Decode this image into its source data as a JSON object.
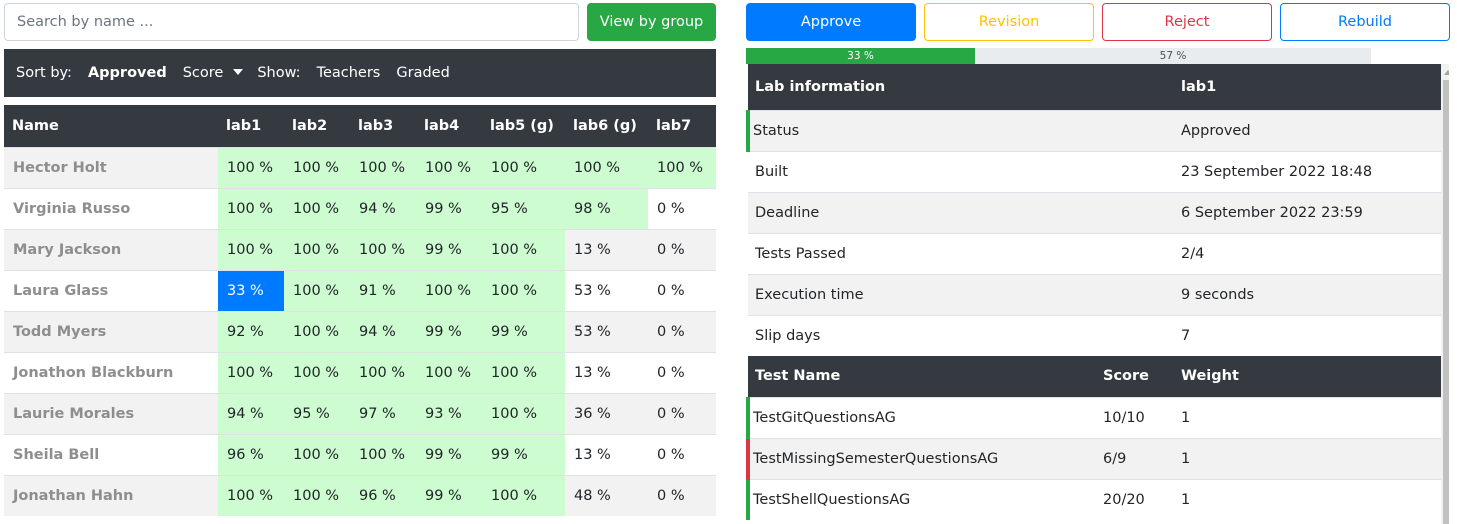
{
  "search": {
    "placeholder": "Search by name ..."
  },
  "view_by_group_label": "View by group",
  "sortbar": {
    "sort_by_label": "Sort by:",
    "approved_label": "Approved",
    "score_label": "Score",
    "show_label": "Show:",
    "teachers_label": "Teachers",
    "graded_label": "Graded"
  },
  "results_table": {
    "headers": [
      "Name",
      "lab1",
      "lab2",
      "lab3",
      "lab4",
      "lab5 (g)",
      "lab6 (g)",
      "lab7"
    ],
    "rows": [
      {
        "name": "Hector Holt",
        "cells": [
          "100 %",
          "100 %",
          "100 %",
          "100 %",
          "100 %",
          "100 %",
          "100 %"
        ]
      },
      {
        "name": "Virginia Russo",
        "cells": [
          "100 %",
          "100 %",
          "94 %",
          "99 %",
          "95 %",
          "98 %",
          "0 %"
        ]
      },
      {
        "name": "Mary Jackson",
        "cells": [
          "100 %",
          "100 %",
          "100 %",
          "99 %",
          "100 %",
          "13 %",
          "0 %"
        ]
      },
      {
        "name": "Laura Glass",
        "cells": [
          "33 %",
          "100 %",
          "91 %",
          "100 %",
          "100 %",
          "53 %",
          "0 %"
        ]
      },
      {
        "name": "Todd Myers",
        "cells": [
          "92 %",
          "100 %",
          "94 %",
          "99 %",
          "99 %",
          "53 %",
          "0 %"
        ]
      },
      {
        "name": "Jonathon Blackburn",
        "cells": [
          "100 %",
          "100 %",
          "100 %",
          "100 %",
          "100 %",
          "13 %",
          "0 %"
        ]
      },
      {
        "name": "Laurie Morales",
        "cells": [
          "94 %",
          "95 %",
          "97 %",
          "93 %",
          "100 %",
          "36 %",
          "0 %"
        ]
      },
      {
        "name": "Sheila Bell",
        "cells": [
          "96 %",
          "100 %",
          "100 %",
          "99 %",
          "99 %",
          "13 %",
          "0 %"
        ]
      },
      {
        "name": "Jonathan Hahn",
        "cells": [
          "100 %",
          "100 %",
          "96 %",
          "99 %",
          "100 %",
          "48 %",
          "0 %"
        ]
      }
    ]
  },
  "actions": {
    "approve": "Approve",
    "revision": "Revision",
    "reject": "Reject",
    "rebuild": "Rebuild"
  },
  "progress": {
    "passed_label": "33 %",
    "passed_fraction": 0.33,
    "remaining_label": "57 %",
    "remaining_fraction": 0.57
  },
  "lab_info": {
    "header_label": "Lab information",
    "header_value": "lab1",
    "rows": [
      {
        "label": "Status",
        "value": "Approved"
      },
      {
        "label": "Built",
        "value": "23 September 2022 18:48"
      },
      {
        "label": "Deadline",
        "value": "6 September 2022 23:59"
      },
      {
        "label": "Tests Passed",
        "value": "2/4"
      },
      {
        "label": "Execution time",
        "value": "9 seconds"
      },
      {
        "label": "Slip days",
        "value": "7"
      }
    ]
  },
  "tests": {
    "headers": [
      "Test Name",
      "Score",
      "Weight"
    ],
    "rows": [
      {
        "name": "TestGitQuestionsAG",
        "score": "10/10",
        "weight": "1",
        "status": "pass"
      },
      {
        "name": "TestMissingSemesterQuestionsAG",
        "score": "6/9",
        "weight": "1",
        "status": "fail"
      },
      {
        "name": "TestShellQuestionsAG",
        "score": "20/20",
        "weight": "1",
        "status": "pass"
      }
    ]
  },
  "colors": {
    "dark": "#343a40",
    "success": "#28a745",
    "primary": "#007bff",
    "warning": "#ffc107",
    "danger": "#dc3545",
    "complete_cell": "#ccfccf"
  }
}
